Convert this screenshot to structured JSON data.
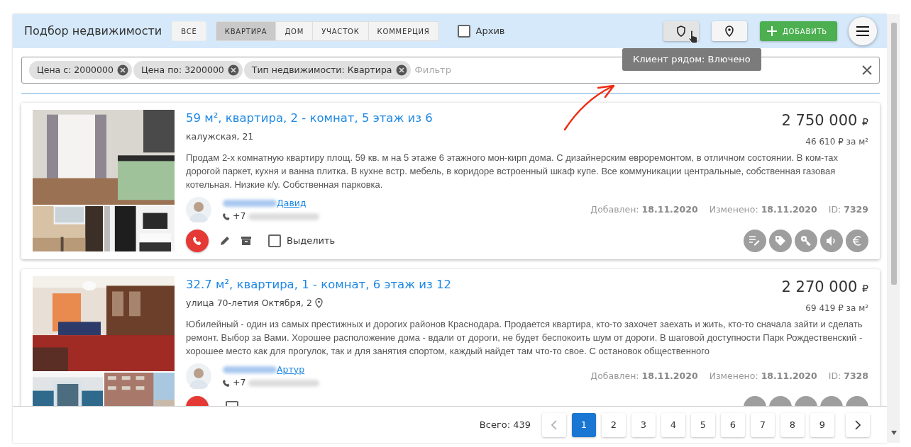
{
  "header": {
    "title": "Подбор недвижимости",
    "all_button": {
      "label": "ВСЕ",
      "selected": false
    },
    "type_tabs": [
      {
        "label": "КВАРТИРА",
        "selected": true
      },
      {
        "label": "ДОМ",
        "selected": false
      },
      {
        "label": "УЧАСТОК",
        "selected": false
      },
      {
        "label": "КОММЕРЦИЯ",
        "selected": false
      }
    ],
    "archive": {
      "label": "Архив",
      "checked": false
    },
    "add_button": "ДОБАВИТЬ",
    "tooltip": "Клиент рядом: Влючено"
  },
  "filter": {
    "chips": [
      {
        "label": "Цена с: 2000000"
      },
      {
        "label": "Цена по: 3200000"
      },
      {
        "label": "Тип недвижимости: Квартира"
      }
    ],
    "placeholder": "Фильтр"
  },
  "listings": [
    {
      "title": "59 м², квартира, 2 - комнат, 5 этаж из 6",
      "address": "калужская, 21",
      "map_pin": false,
      "price": "2 750 000",
      "currency": "₽",
      "price_per_m": "46 610 ₽ за м²",
      "description": "Продам 2-х комнатную квартиру площ. 59 кв. м на 5 этаже 6 этажного мон-кирп дома. С дизайнерским евроремонтом, в отличном состоянии. В ком-тах дорогой паркет, кухня и ванна плитка. В кухне встр. мебель, в коридоре встроенный шкаф купе. Все коммуникации центральные, собственная газовая котельная. Низкие к/у. Собственная парковка.",
      "agent": "Давид",
      "phone": "+7",
      "added_label": "Добавлен:",
      "added": "18.11.2020",
      "changed_label": "Изменено:",
      "changed": "18.11.2020",
      "id_label": "ID:",
      "id": "7329",
      "select_label": "Выделить",
      "checked": false
    },
    {
      "title": "32.7 м², квартира, 1 - комнат, 6 этаж из 12",
      "address": "улица 70-летия Октября, 2",
      "map_pin": true,
      "price": "2 270 000",
      "currency": "₽",
      "price_per_m": "69 419 ₽ за м²",
      "description": "Юбилейный - один из самых престижных и дорогих районов Краснодара. Продается квартира, кто-то захочет заехать и жить, кто-то сначала зайти и сделать ремонт. Выбор за Вами. Хорошее расположение дома - вдали от дороги, не будет беспокоить шум от дороги. В шаговой доступности Парк Рождественский - хорошее место как для прогулок, так и для занятия спортом, каждый найдет там что-то свое. С остановок общественного",
      "agent": "Артур",
      "phone": "+7",
      "added_label": "Добавлен:",
      "added": "18.11.2020",
      "changed_label": "Изменено:",
      "changed": "18.11.2020",
      "id_label": "ID:",
      "id": "7328",
      "checked": false
    }
  ],
  "footer": {
    "total": "Всего: 439",
    "pages": [
      {
        "label": "1",
        "selected": true
      },
      {
        "label": "2",
        "selected": false
      },
      {
        "label": "3",
        "selected": false
      },
      {
        "label": "4",
        "selected": false
      },
      {
        "label": "5",
        "selected": false
      },
      {
        "label": "6",
        "selected": false
      },
      {
        "label": "7",
        "selected": false
      },
      {
        "label": "8",
        "selected": false
      },
      {
        "label": "9",
        "selected": false
      }
    ]
  }
}
